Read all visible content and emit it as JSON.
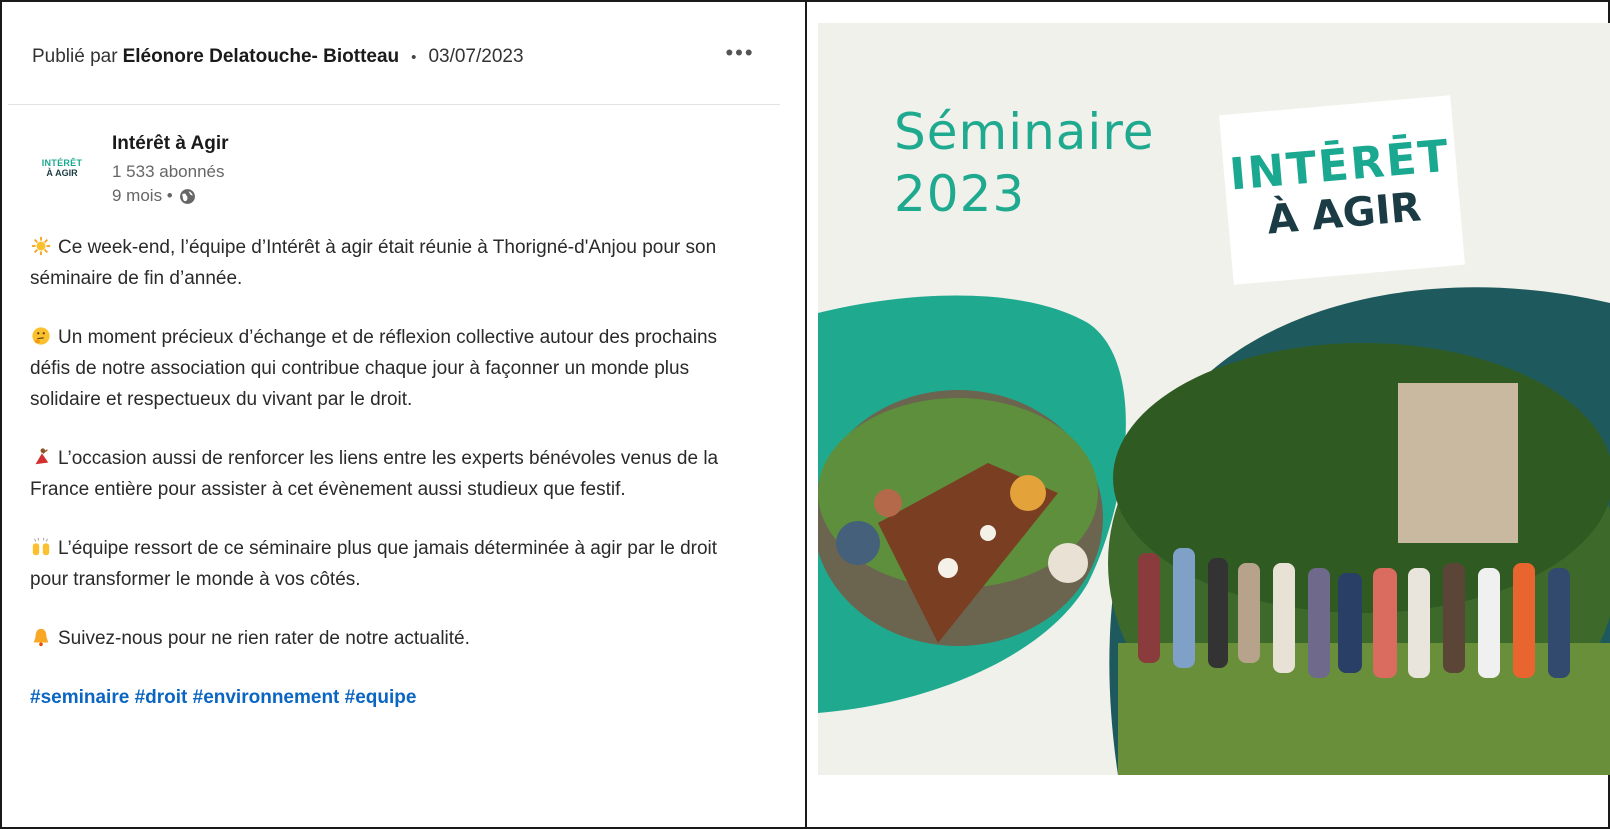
{
  "post": {
    "published_prefix": "Publié par",
    "author": "Eléonore Delatouche- Biotteau",
    "separator": "•",
    "date": "03/07/2023",
    "more_label": "•••",
    "company": {
      "logo_line1": "INTÉRÊT",
      "logo_line2": "À AGIR",
      "name": "Intérêt à Agir",
      "followers": "1 533 abonnés",
      "age": "9 mois •"
    },
    "paragraphs": [
      {
        "icon": "sun-icon",
        "text": "Ce week-end, l’équipe d’Intérêt à agir était réunie à Thorigné-d'Anjou pour son séminaire de fin d’année."
      },
      {
        "icon": "thinking-face-icon",
        "text": "Un moment précieux d’échange et de réflexion collective autour des prochains défis de notre association qui contribue chaque jour à façonner un monde plus solidaire et respectueux du vivant par le droit."
      },
      {
        "icon": "dancer-icon",
        "text": "L’occasion aussi de renforcer les liens entre les experts bénévoles venus de la France entière pour assister à cet évènement aussi studieux que festif."
      },
      {
        "icon": "raised-hands-icon",
        "text": "L’équipe ressort de ce séminaire plus que jamais déterminée à agir par le droit pour transformer le monde à vos côtés."
      },
      {
        "icon": "bell-icon",
        "text": "Suivez-nous pour ne rien rater de notre actualité."
      }
    ],
    "hashtags": "#seminaire #droit #environnement #equipe"
  },
  "visual": {
    "title_line1": "Séminaire",
    "title_line2": "2023",
    "logo_line1": "INTĒRĒT",
    "logo_line2": "À AGIR",
    "colors": {
      "background": "#f1f1ec",
      "teal": "#1faa8f",
      "dark_teal": "#1e5a5d",
      "navy": "#1b3c44"
    }
  }
}
